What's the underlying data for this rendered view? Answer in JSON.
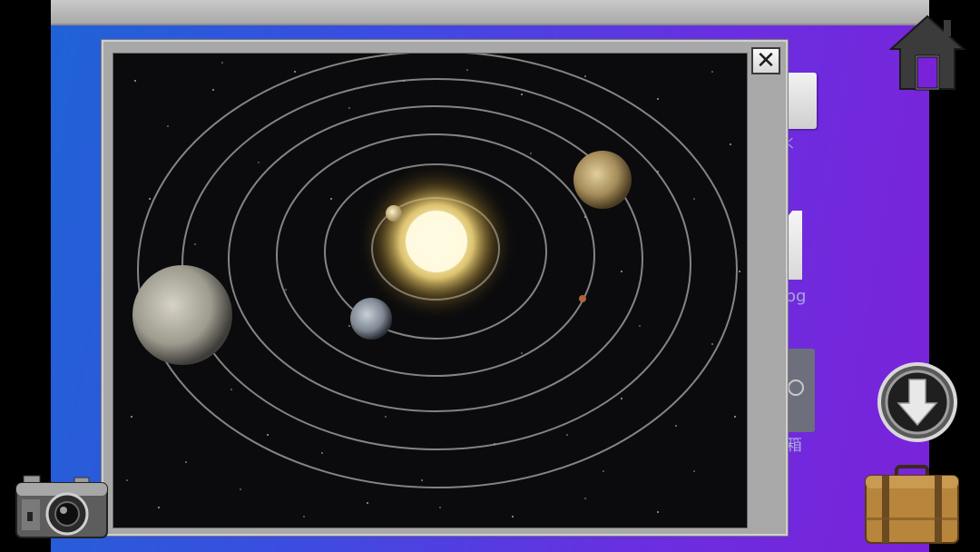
{
  "window": {
    "close_label": "✕",
    "image": "solar-system-diagram"
  },
  "desktop_icons": [
    {
      "name": "note-icon",
      "label": "く"
    },
    {
      "name": "document-icon",
      "label": "og"
    },
    {
      "name": "safe-icon",
      "label": "箱"
    }
  ],
  "controls": {
    "home": "house-icon",
    "download": "download-arrow-icon",
    "inventory": "suitcase-icon",
    "camera": "camera-icon"
  },
  "colors": {
    "desktop_left": "#1f63d6",
    "desktop_right": "#7a22d8",
    "window_frame": "#a8a8a8",
    "space": "#0b0b0d",
    "orbit": "#9a9a9a",
    "sun": "#fff4b0"
  }
}
